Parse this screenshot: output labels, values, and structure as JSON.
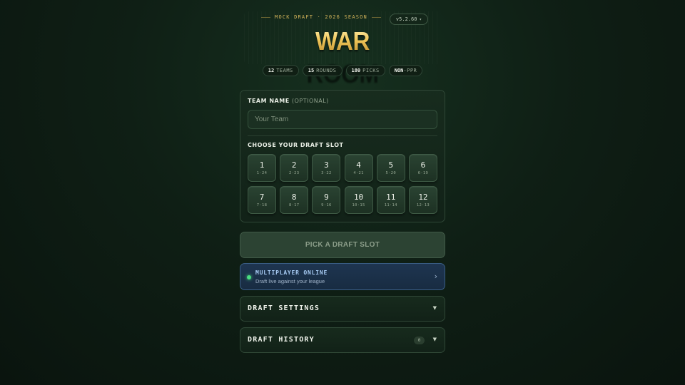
{
  "header": {
    "season_text": "MOCK DRAFT · 2026 SEASON",
    "version": "v5.2.60",
    "version_icon": "chevron-down-icon",
    "title": "WAR ROOM"
  },
  "stats": [
    {
      "num": "12",
      "label": "TEAMS"
    },
    {
      "num": "15",
      "label": "ROUNDS"
    },
    {
      "num": "180",
      "label": "PICKS"
    },
    {
      "num": "NON",
      "label": "-PPR"
    }
  ],
  "team": {
    "label": "TEAM NAME",
    "optional": "(OPTIONAL)",
    "placeholder": "Your Team",
    "value": ""
  },
  "slots": {
    "label": "CHOOSE YOUR DRAFT SLOT",
    "items": [
      {
        "n": "1",
        "picks": "1·24"
      },
      {
        "n": "2",
        "picks": "2·23"
      },
      {
        "n": "3",
        "picks": "3·22"
      },
      {
        "n": "4",
        "picks": "4·21"
      },
      {
        "n": "5",
        "picks": "5·20"
      },
      {
        "n": "6",
        "picks": "6·19"
      },
      {
        "n": "7",
        "picks": "7·18"
      },
      {
        "n": "8",
        "picks": "8·17"
      },
      {
        "n": "9",
        "picks": "9·16"
      },
      {
        "n": "10",
        "picks": "10·15"
      },
      {
        "n": "11",
        "picks": "11·14"
      },
      {
        "n": "12",
        "picks": "12·13"
      }
    ]
  },
  "pick_button": "PICK A DRAFT SLOT",
  "multiplayer": {
    "title": "MULTIPLAYER ONLINE",
    "subtitle": "Draft live against your league",
    "chevron": "›"
  },
  "settings": {
    "label": "DRAFT SETTINGS",
    "arrow": "▼"
  },
  "history": {
    "label": "DRAFT HISTORY",
    "count": "0",
    "arrow": "▼"
  },
  "colors": {
    "accent_gold": "#f0c75a",
    "online_green": "#4ade80",
    "multiplayer_blue": "#a8ccf4"
  }
}
